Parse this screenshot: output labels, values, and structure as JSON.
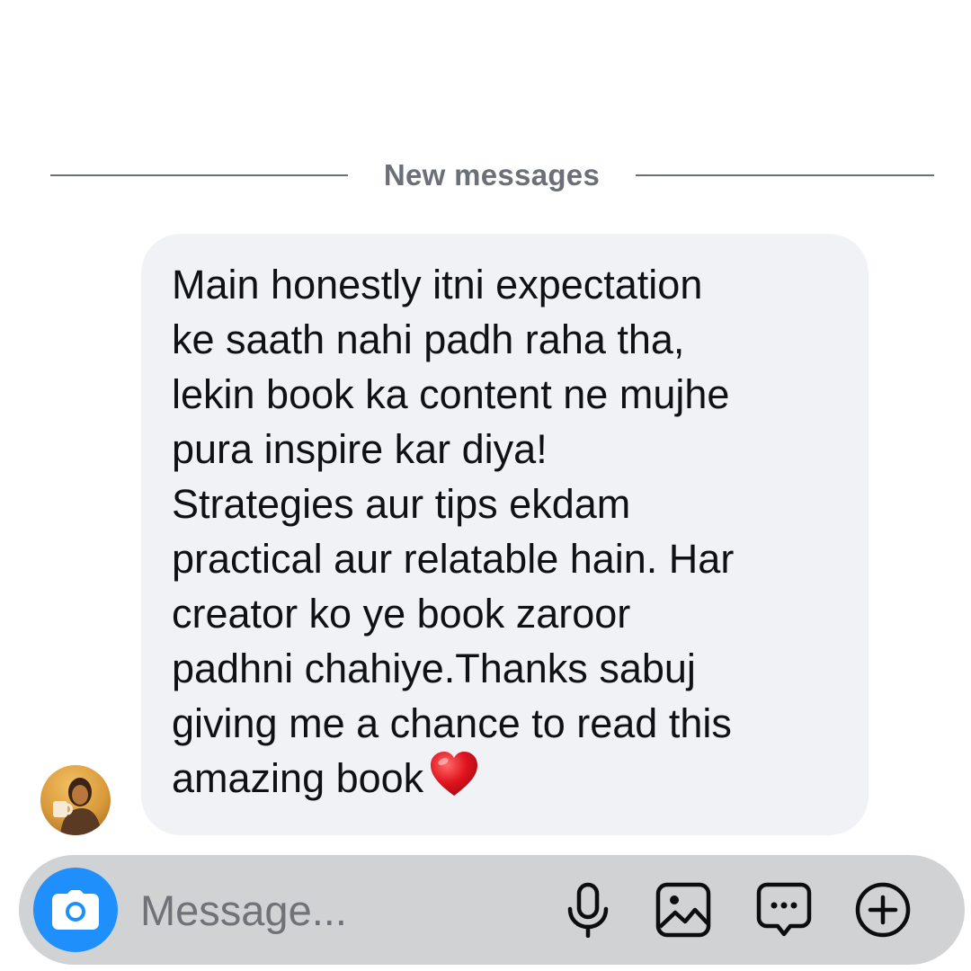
{
  "divider": {
    "label": "New messages"
  },
  "message": {
    "lines": [
      "Main honestly itni expectation",
      "ke saath nahi padh raha tha,",
      "lekin book ka content ne mujhe",
      "pura inspire kar diya!",
      "Strategies aur tips ekdam",
      "practical aur relatable hain. Har",
      "creator ko ye book zaroor",
      "padhni chahiye.Thanks sabuj",
      "giving me a chance to read this",
      "amazing book"
    ],
    "emoji": "heart-icon"
  },
  "composer": {
    "placeholder": "Message...",
    "camera_icon": "camera-icon",
    "mic_icon": "microphone-icon",
    "gallery_icon": "gallery-icon",
    "sticker_icon": "sticker-icon",
    "plus_icon": "plus-circle-icon"
  },
  "colors": {
    "accent": "#1e8ffb",
    "bubble": "#f1f2f5",
    "composer": "#d1d2d4",
    "divider": "#6b7078",
    "heart": "#e0141e"
  }
}
